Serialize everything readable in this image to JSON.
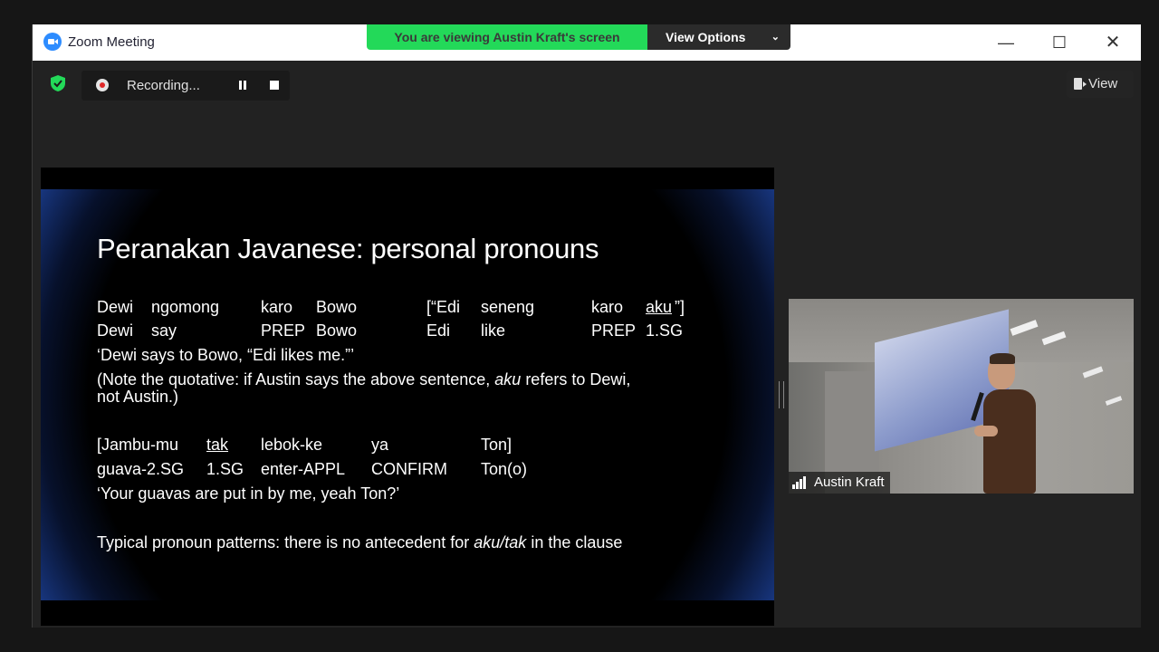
{
  "window": {
    "title": "Zoom Meeting"
  },
  "window_controls": {
    "minimize": "—",
    "maximize": "☐",
    "close": "✕"
  },
  "share_banner": {
    "viewing_text": "You are viewing Austin Kraft's screen",
    "view_options_label": "View Options"
  },
  "toolbar": {
    "recording_label": "Recording...",
    "view_label": "View"
  },
  "colors": {
    "banner_green": "#23d959",
    "security_green": "#23d959",
    "recording_red": "#e02828"
  },
  "icons": [
    "zoom-logo-icon",
    "security-shield-icon",
    "record-dot-icon",
    "pause-icon",
    "stop-icon",
    "view-icon",
    "chevron-down-icon",
    "signal-strength-icon"
  ],
  "slide": {
    "title": "Peranakan Javanese: personal pronouns",
    "ex1_line1": [
      "Dewi",
      "ngomong",
      "karo",
      "Bowo",
      "[“Edi",
      "seneng",
      "karo",
      "aku",
      "”]"
    ],
    "ex1_line2": [
      "Dewi",
      "say",
      "PREP",
      "Bowo",
      "Edi",
      "like",
      "PREP",
      "1.SG"
    ],
    "ex1_translation": "‘Dewi says to Bowo, “Edi likes me.”’",
    "note_part1": "(Note the quotative: if Austin says the above sentence, ",
    "note_italic": "aku",
    "note_part2": " refers to Dewi,",
    "note_line2": "not Austin.)",
    "ex2_line1": [
      "[Jambu-mu",
      "tak",
      "lebok-ke",
      "ya",
      "Ton]"
    ],
    "ex2_line2": [
      "guava-2.SG",
      "1.SG",
      "enter-APPL",
      "CONFIRM",
      "Ton(o)"
    ],
    "ex2_translation": "‘Your guavas are put in by me, yeah Ton?’",
    "summary_part1": "Typical pronoun patterns: there is no antecedent for ",
    "summary_italic": "aku/tak",
    "summary_part2": " in the clause"
  },
  "video": {
    "participant_name": "Austin Kraft"
  }
}
